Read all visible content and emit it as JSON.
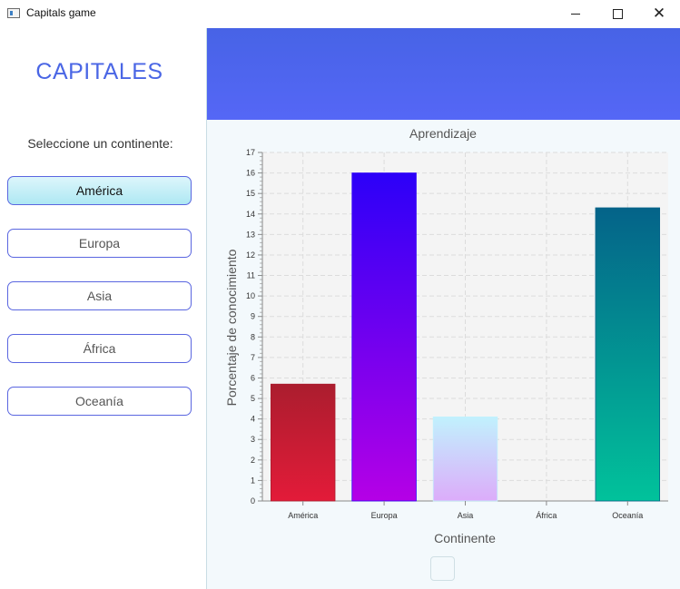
{
  "window": {
    "title": "Capitals game"
  },
  "sidebar": {
    "logo": "CAPITALES",
    "prompt": "Seleccione un continente:",
    "buttons": [
      {
        "label": "América",
        "active": true
      },
      {
        "label": "Europa",
        "active": false
      },
      {
        "label": "Asia",
        "active": false
      },
      {
        "label": "África",
        "active": false
      },
      {
        "label": "Oceanía",
        "active": false
      }
    ]
  },
  "chart_data": {
    "type": "bar",
    "title": "Aprendizaje",
    "xlabel": "Continente",
    "ylabel": "Porcentaje de conocimiento",
    "categories": [
      "América",
      "Europa",
      "Asia",
      "África",
      "Oceanía"
    ],
    "values": [
      5.7,
      16.0,
      4.1,
      0,
      14.3
    ],
    "ylim": [
      0,
      17
    ],
    "yticks": [
      "0",
      "1",
      "2",
      "3",
      "4",
      "5",
      "6",
      "7",
      "8",
      "9",
      "10",
      "11",
      "12",
      "13",
      "14",
      "15",
      "16",
      "17"
    ],
    "grid": true,
    "gradients": [
      [
        "#ab1d2e",
        "#e31b39"
      ],
      [
        "#2c00f8",
        "#b500e6"
      ],
      [
        "#c1f1fd",
        "#dcacfa"
      ],
      [
        "#cccccc",
        "#cccccc"
      ],
      [
        "#046389",
        "#01c29b"
      ]
    ]
  }
}
